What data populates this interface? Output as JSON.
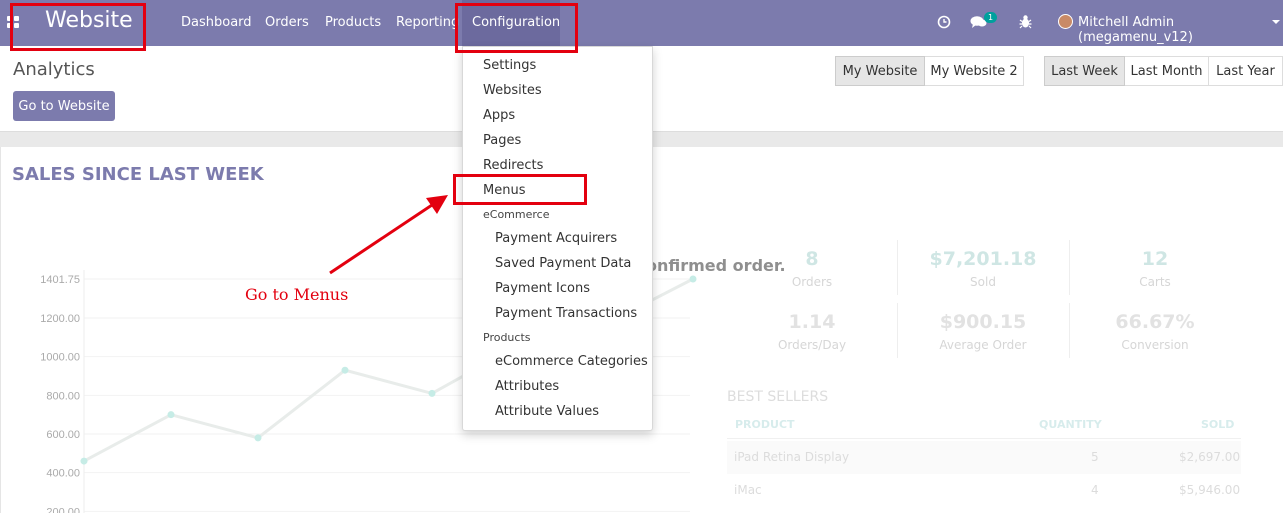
{
  "navbar": {
    "brand": "Website",
    "menu": [
      "Dashboard",
      "Orders",
      "Products",
      "Reporting",
      "Configuration"
    ],
    "chat_badge": "1",
    "user": "Mitchell Admin (megamenu_v12)"
  },
  "page": {
    "title": "Analytics",
    "go_button": "Go to Website",
    "website_filters": [
      "My Website",
      "My Website 2"
    ],
    "period_filters": [
      "Last Week",
      "Last Month",
      "Last Year"
    ]
  },
  "dashboard": {
    "sales_title": "SALES SINCE LAST WEEK",
    "ghost_text": "onfirmed order.",
    "kpis": [
      {
        "value": "8",
        "label": "Orders"
      },
      {
        "value": "$7,201.18",
        "label": "Sold"
      },
      {
        "value": "12",
        "label": "Carts"
      },
      {
        "value": "1.14",
        "label": "Orders/Day"
      },
      {
        "value": "$900.15",
        "label": "Average Order"
      },
      {
        "value": "66.67%",
        "label": "Conversion"
      }
    ],
    "best_sellers": {
      "title": "BEST SELLERS",
      "headers": [
        "PRODUCT",
        "QUANTITY",
        "SOLD"
      ],
      "rows": [
        [
          "iPad Retina Display",
          "5",
          "$2,697.00"
        ],
        [
          "iMac",
          "4",
          "$5,946.00"
        ]
      ]
    }
  },
  "chart_data": {
    "type": "line",
    "y_ticks": [
      "1401.75",
      "1200.00",
      "1000.00",
      "800.00",
      "600.00",
      "400.00",
      "200.00"
    ],
    "ylim": [
      0,
      1401.75
    ],
    "values": [
      460,
      700,
      580,
      930,
      810,
      1060,
      1170,
      1401.75
    ]
  },
  "dropdown": {
    "items": [
      {
        "label": "Settings",
        "type": "item"
      },
      {
        "label": "Websites",
        "type": "item"
      },
      {
        "label": "Apps",
        "type": "item"
      },
      {
        "label": "Pages",
        "type": "item"
      },
      {
        "label": "Redirects",
        "type": "item"
      },
      {
        "label": "Menus",
        "type": "item"
      },
      {
        "label": "eCommerce",
        "type": "header"
      },
      {
        "label": "Payment Acquirers",
        "type": "sub"
      },
      {
        "label": "Saved Payment Data",
        "type": "sub"
      },
      {
        "label": "Payment Icons",
        "type": "sub"
      },
      {
        "label": "Payment Transactions",
        "type": "sub"
      },
      {
        "label": "Products",
        "type": "header"
      },
      {
        "label": "eCommerce Categories",
        "type": "sub"
      },
      {
        "label": "Attributes",
        "type": "sub"
      },
      {
        "label": "Attribute Values",
        "type": "sub"
      }
    ]
  },
  "annotation": {
    "text": "Go to Menus",
    "color": "#e3000f"
  },
  "colors": {
    "navbar": "#7c7bad",
    "accent": "#7c7bad",
    "highlight": "#e3000f"
  }
}
